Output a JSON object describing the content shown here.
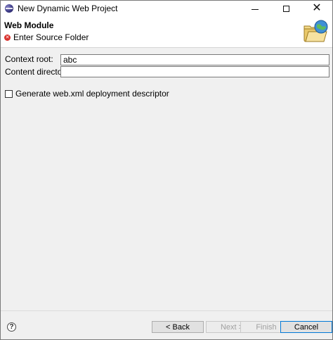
{
  "window": {
    "title": "New Dynamic Web Project"
  },
  "header": {
    "title": "Web Module",
    "message": "Enter Source Folder",
    "banner_icon": "folder-globe-icon"
  },
  "form": {
    "context_root": {
      "label": "Context root:",
      "value": "abc"
    },
    "content_directory": {
      "label": "Content directory:",
      "value": ""
    },
    "generate_descriptor": {
      "label": "Generate web.xml deployment descriptor",
      "checked": false
    }
  },
  "footer": {
    "back_label": "< Back",
    "next_label": "Next >",
    "finish_label": "Finish",
    "cancel_label": "Cancel"
  },
  "colors": {
    "error": "#d9302c",
    "focus_border": "#0078d7"
  }
}
